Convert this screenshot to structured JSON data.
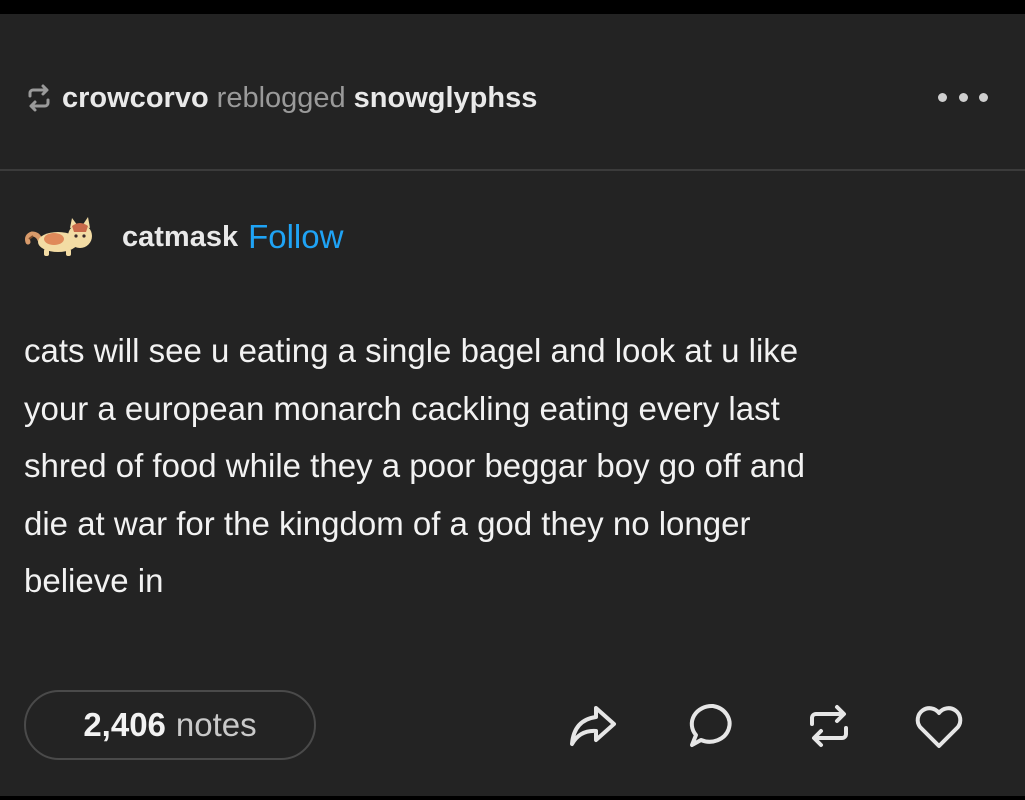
{
  "reblog": {
    "reblogger": "crowcorvo",
    "verb": "reblogged",
    "source": "snowglyphss"
  },
  "author": {
    "name": "catmask",
    "follow_label": "Follow"
  },
  "post": {
    "lines": [
      "cats will see u eating a single bagel and look at u like",
      "your a european monarch cackling eating every last",
      "shred of food while they a poor beggar boy go off and",
      "die at war for the kingdom of a god they no longer",
      "believe in"
    ]
  },
  "footer": {
    "notes_count": "2,406",
    "notes_label": "notes"
  },
  "icons": {
    "reblog": "reblog-icon",
    "more": "more-icon",
    "share": "share-icon",
    "reply": "reply-icon",
    "reblog_action": "reblog-icon",
    "like": "heart-icon"
  },
  "colors": {
    "background": "#232323",
    "follow": "#1fa3f5",
    "text": "#f2f2f2",
    "muted": "#9a9a9a"
  }
}
